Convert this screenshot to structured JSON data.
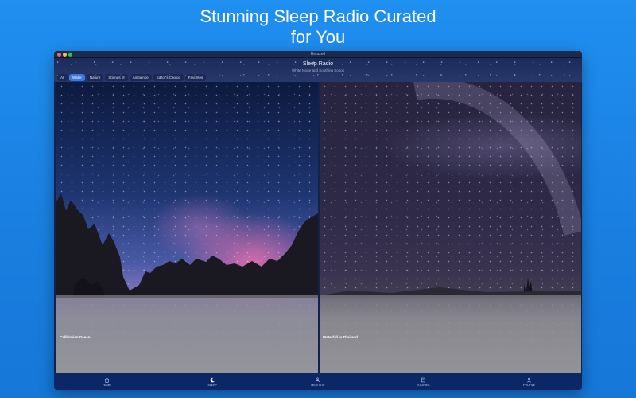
{
  "headline": {
    "line1": "Stunning Sleep Radio Curated",
    "line2": "for You"
  },
  "window": {
    "title": "Relaxed"
  },
  "header": {
    "title": "Sleep Radio",
    "subtitle": "White Noise and Soothing Songs"
  },
  "tabs": [
    {
      "label": "All",
      "active": false
    },
    {
      "label": "Water",
      "active": true
    },
    {
      "label": "Nature",
      "active": false
    },
    {
      "label": "Sounds of",
      "active": false
    },
    {
      "label": "Ambience",
      "active": false
    },
    {
      "label": "Editor's Choice",
      "active": false
    },
    {
      "label": "Favorites",
      "active": false
    }
  ],
  "cards": [
    {
      "label": "Californian Ocean"
    },
    {
      "label": "Waterfall in Thailand"
    }
  ],
  "bottom_nav": [
    {
      "label": "HOME",
      "icon": "home-icon"
    },
    {
      "label": "SLEEP",
      "icon": "moon-icon"
    },
    {
      "label": "MEDITATE",
      "icon": "meditate-icon"
    },
    {
      "label": "STORIES",
      "icon": "book-icon"
    },
    {
      "label": "PROFILE",
      "icon": "person-icon"
    }
  ],
  "colors": {
    "background": "#1f8ff0",
    "accent": "#3a7ae0",
    "nav_bar": "#0c2766"
  }
}
